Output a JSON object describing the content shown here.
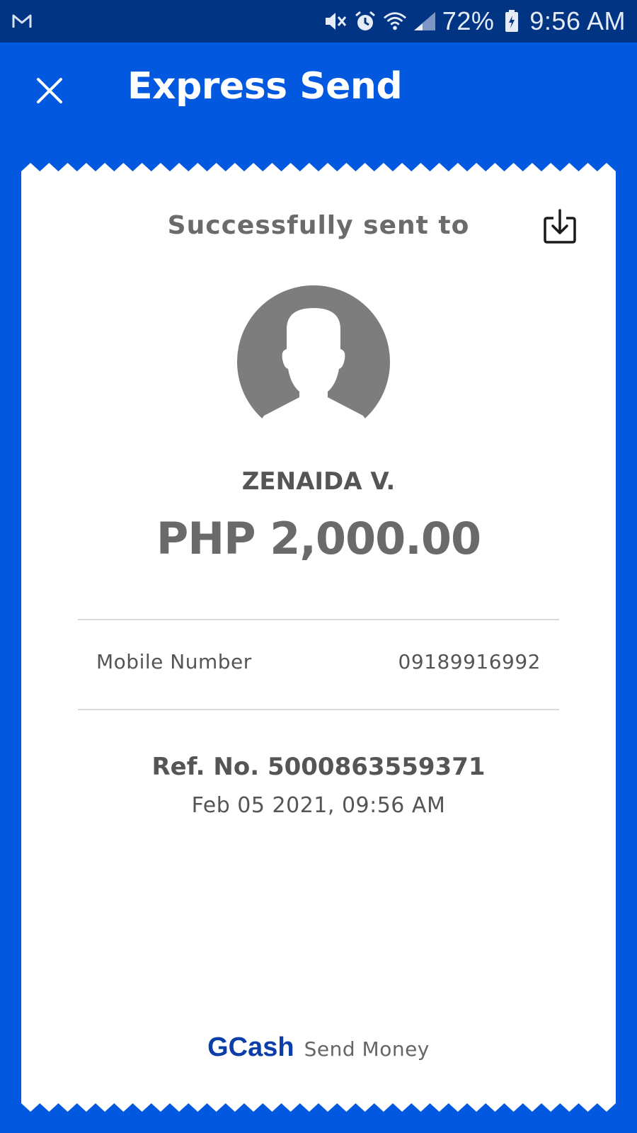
{
  "status_bar": {
    "battery": "72%",
    "time": "9:56 AM",
    "icons": [
      "gmail-icon",
      "mute-icon",
      "alarm-icon",
      "wifi-icon",
      "signal-icon",
      "battery-icon"
    ]
  },
  "header": {
    "title": "Express Send",
    "close_icon": "close-icon"
  },
  "receipt": {
    "heading": "Successfully sent to",
    "download_icon": "download-icon",
    "avatar_icon": "avatar-placeholder-icon",
    "recipient_name": "ZENAIDA V.",
    "amount": "PHP 2,000.00",
    "details": [
      {
        "label": "Mobile Number",
        "value": "09189916992"
      }
    ],
    "reference": "Ref. No. 5000863559371",
    "date": "Feb 05 2021, 09:56 AM",
    "footer": {
      "brand": "GCash",
      "subtitle": "Send Money"
    }
  },
  "colors": {
    "brand_blue": "#0258DE",
    "status_bar": "#013584",
    "brand_text": "#0B3EA8",
    "avatar_gray": "#7d7d7d"
  }
}
